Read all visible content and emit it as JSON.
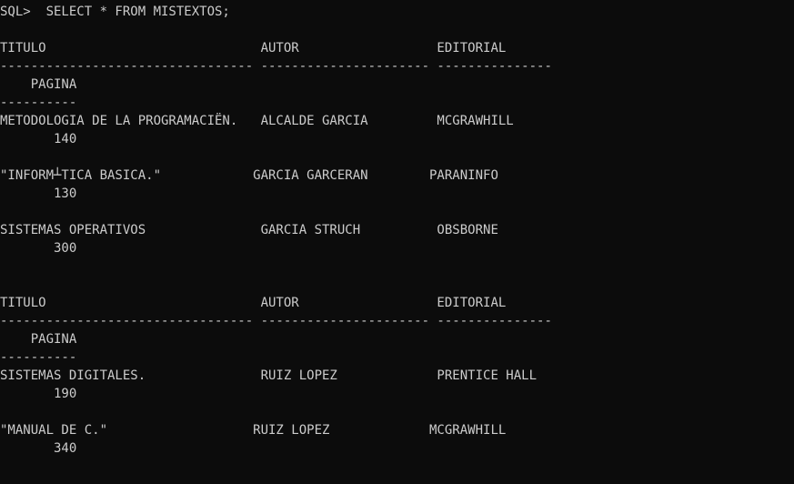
{
  "terminal": {
    "lines": [
      "SQL>  SELECT * FROM MISTEXTOS;",
      "",
      "TITULO                            AUTOR                  EDITORIAL",
      "--------------------------------- ---------------------- ---------------",
      "    PAGINA",
      "----------",
      "METODOLOGIA DE LA PROGRAMACIËN.   ALCALDE GARCIA         MCGRAWHILL",
      "       140",
      "",
      "\"INFORM┴TICA BASICA.\"            GARCIA GARCERAN        PARANINFO",
      "       130",
      "",
      "SISTEMAS OPERATIVOS               GARCIA STRUCH          OBSBORNE",
      "       300",
      "",
      "",
      "TITULO                            AUTOR                  EDITORIAL",
      "--------------------------------- ---------------------- ---------------",
      "    PAGINA",
      "----------",
      "SISTEMAS DIGITALES.               RUIZ LOPEZ             PRENTICE HALL",
      "       190",
      "",
      "\"MANUAL DE C.\"                   RUIZ LOPEZ             MCGRAWHILL",
      "       340"
    ]
  }
}
